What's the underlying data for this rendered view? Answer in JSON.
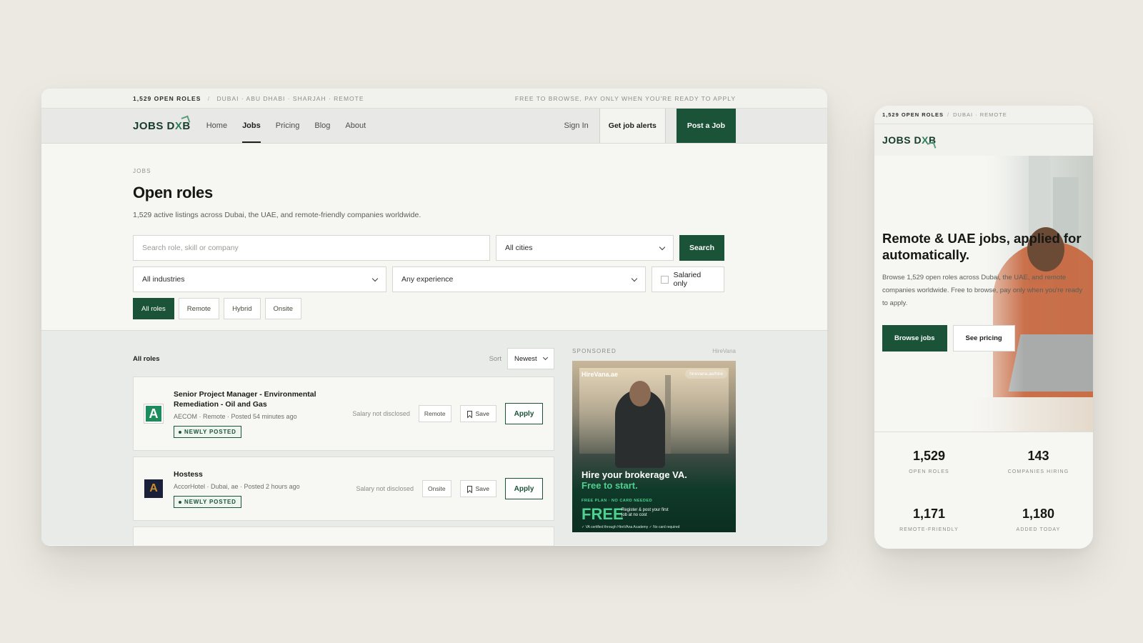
{
  "desktop": {
    "topstrip": {
      "open_roles": "1,529 OPEN ROLES",
      "cities": "DUBAI · ABU DHABI · SHARJAH · REMOTE",
      "tagline": "FREE TO BROWSE, PAY ONLY WHEN YOU'RE READY TO APPLY"
    },
    "logo": {
      "part1": "JOBS D",
      "x": "X",
      "part2": "B"
    },
    "nav": {
      "links": [
        "Home",
        "Jobs",
        "Pricing",
        "Blog",
        "About"
      ],
      "active": "Jobs",
      "signin": "Sign In",
      "alerts": "Get job alerts",
      "post_job": "Post a Job"
    },
    "hero": {
      "eyebrow": "JOBS",
      "title": "Open roles",
      "subtitle": "1,529 active listings across Dubai, the UAE, and remote-friendly companies worldwide.",
      "search_placeholder": "Search role, skill or company",
      "city_select": "All cities",
      "search_button": "Search",
      "industry_select": "All industries",
      "experience_select": "Any experience",
      "salaried_label": "Salaried only",
      "chips": [
        "All roles",
        "Remote",
        "Hybrid",
        "Onsite"
      ],
      "active_chip": "All roles"
    },
    "list": {
      "title": "All roles",
      "sort_label": "Sort",
      "sort_value": "Newest",
      "jobs": [
        {
          "title": "Senior Project Manager - Environmental Remediation - Oil and Gas",
          "logo_letter": "A",
          "meta": "AECOM · Remote · Posted 54 minutes ago",
          "badge": "NEWLY POSTED",
          "salary": "Salary not disclosed",
          "tag": "Remote",
          "save": "Save",
          "apply": "Apply"
        },
        {
          "title": "Hostess",
          "logo_letter": "A",
          "meta": "AccorHotel · Dubai, ae · Posted 2 hours ago",
          "badge": "NEWLY POSTED",
          "salary": "Salary not disclosed",
          "tag": "Onsite",
          "save": "Save",
          "apply": "Apply"
        }
      ]
    },
    "sponsor": {
      "label": "SPONSORED",
      "brand": "HireVana",
      "ad_brand": "HireVana.ae",
      "ad_url": "hirevana.ae/hire",
      "headline": "Hire your brokerage VA.",
      "headline2": "Free to start.",
      "plan": "FREE PLAN · NO CARD NEEDED",
      "free": "FREE",
      "register": "Register & post your first job at no cost",
      "fine": "✓ VA certified through HireVAna Academy   ✓ No card required"
    }
  },
  "mobile": {
    "strip": {
      "open_roles": "1,529 OPEN ROLES",
      "cities": "DUBAI · REMOTE"
    },
    "hero": {
      "title": "Remote & UAE jobs, applied for automatically.",
      "subtitle": "Browse 1,529 open roles across Dubai, the UAE, and remote companies worldwide. Free to browse, pay only when you're ready to apply.",
      "browse_button": "Browse jobs",
      "pricing_button": "See pricing"
    },
    "stats": [
      {
        "value": "1,529",
        "label": "OPEN ROLES"
      },
      {
        "value": "143",
        "label": "COMPANIES HIRING"
      },
      {
        "value": "1,171",
        "label": "REMOTE-FRIENDLY"
      },
      {
        "value": "1,180",
        "label": "ADDED TODAY"
      }
    ]
  },
  "colors": {
    "brand_green": "#1b5338",
    "accent_green": "#4fd08f",
    "background": "#ece9e2"
  }
}
